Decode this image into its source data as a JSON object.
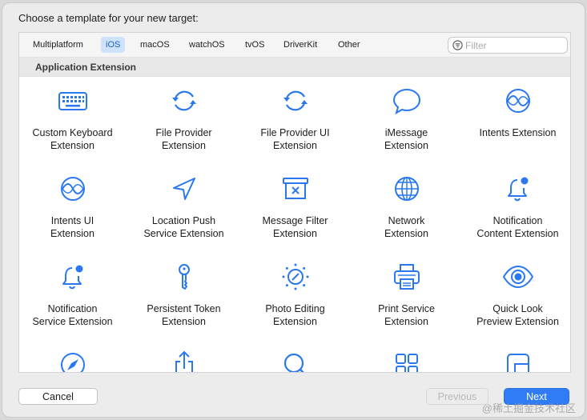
{
  "dialog": {
    "prompt": "Choose a template for your new target:"
  },
  "tabs": [
    {
      "label": "Multiplatform",
      "active": false
    },
    {
      "label": "iOS",
      "active": true
    },
    {
      "label": "macOS",
      "active": false
    },
    {
      "label": "watchOS",
      "active": false
    },
    {
      "label": "tvOS",
      "active": false
    },
    {
      "label": "DriverKit",
      "active": false
    },
    {
      "label": "Other",
      "active": false
    }
  ],
  "filter": {
    "placeholder": "Filter",
    "value": ""
  },
  "section": {
    "title": "Application Extension"
  },
  "templates": [
    {
      "icon": "keyboard-icon",
      "line1": "Custom Keyboard",
      "line2": "Extension"
    },
    {
      "icon": "sync-arrows-icon",
      "line1": "File Provider",
      "line2": "Extension"
    },
    {
      "icon": "sync-arrows-icon",
      "line1": "File Provider UI",
      "line2": "Extension"
    },
    {
      "icon": "speech-bubble-icon",
      "line1": "iMessage",
      "line2": "Extension"
    },
    {
      "icon": "intents-icon",
      "line1": "Intents Extension",
      "line2": ""
    },
    {
      "icon": "intents-icon",
      "line1": "Intents UI",
      "line2": "Extension"
    },
    {
      "icon": "location-arrow-icon",
      "line1": "Location Push",
      "line2": "Service Extension"
    },
    {
      "icon": "message-filter-icon",
      "line1": "Message Filter",
      "line2": "Extension"
    },
    {
      "icon": "globe-icon",
      "line1": "Network",
      "line2": "Extension"
    },
    {
      "icon": "bell-badge-icon",
      "line1": "Notification",
      "line2": "Content Extension"
    },
    {
      "icon": "bell-badge-icon",
      "line1": "Notification",
      "line2": "Service Extension"
    },
    {
      "icon": "key-icon",
      "line1": "Persistent Token",
      "line2": "Extension"
    },
    {
      "icon": "photo-editing-icon",
      "line1": "Photo Editing",
      "line2": "Extension"
    },
    {
      "icon": "printer-icon",
      "line1": "Print Service",
      "line2": "Extension"
    },
    {
      "icon": "eye-icon",
      "line1": "Quick Look",
      "line2": "Preview Extension"
    },
    {
      "icon": "compass-icon",
      "line1": "",
      "line2": ""
    },
    {
      "icon": "share-icon",
      "line1": "",
      "line2": ""
    },
    {
      "icon": "magnifier-icon",
      "line1": "",
      "line2": ""
    },
    {
      "icon": "grid-squares-icon",
      "line1": "",
      "line2": ""
    },
    {
      "icon": "widget-icon",
      "line1": "",
      "line2": ""
    }
  ],
  "buttons": {
    "cancel": "Cancel",
    "previous": "Previous",
    "next": "Next"
  },
  "watermark": "@稀土掘金技术社区",
  "colors": {
    "accent": "#2f7cf6",
    "icon": "#2a78f0",
    "tab_active_bg": "#cfe2fb"
  }
}
